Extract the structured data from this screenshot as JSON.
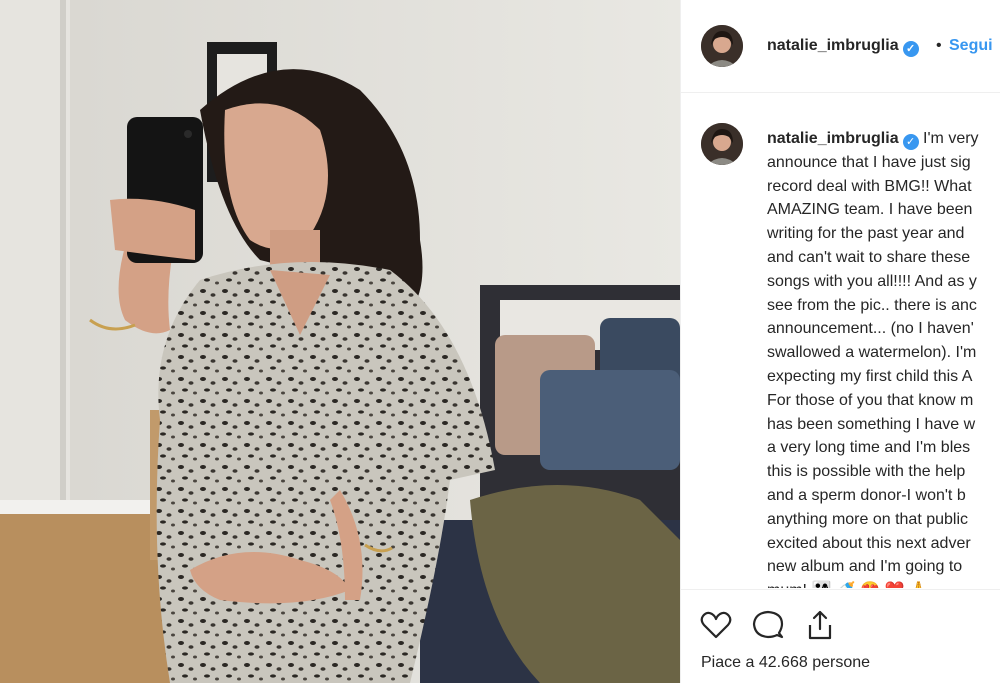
{
  "post": {
    "username": "natalie_imbruglia",
    "verified": true,
    "follow_label": "Segui",
    "separator": "•"
  },
  "caption": {
    "username": "natalie_imbruglia",
    "lines": [
      " I'm very",
      "announce that I have just sig",
      "record deal with BMG!! What",
      "AMAZING team. I have been",
      "writing for the past year and",
      "and can't wait to share these",
      "songs with you all!!!! And as y",
      "see from the pic.. there is anc",
      "announcement... (no I haven'",
      "swallowed a watermelon). I'm",
      "expecting my first child this A",
      "For those of you that know m",
      "has been something I have w",
      "a very long time and I'm bles",
      "this is possible with the help",
      "and a sperm donor-I won't b",
      "anything more on that public",
      "excited about this next adver",
      "new album and I'm going to",
      "mum! 👨‍👩‍👧 🍼 😍 ❤️ 🙏"
    ]
  },
  "actions": {
    "likes_text": "Piace a 42.668 persone",
    "icons": [
      "heart-icon",
      "comment-icon",
      "share-icon"
    ]
  },
  "colors": {
    "link": "#3897f0",
    "text": "#262626",
    "border": "#efefef"
  }
}
